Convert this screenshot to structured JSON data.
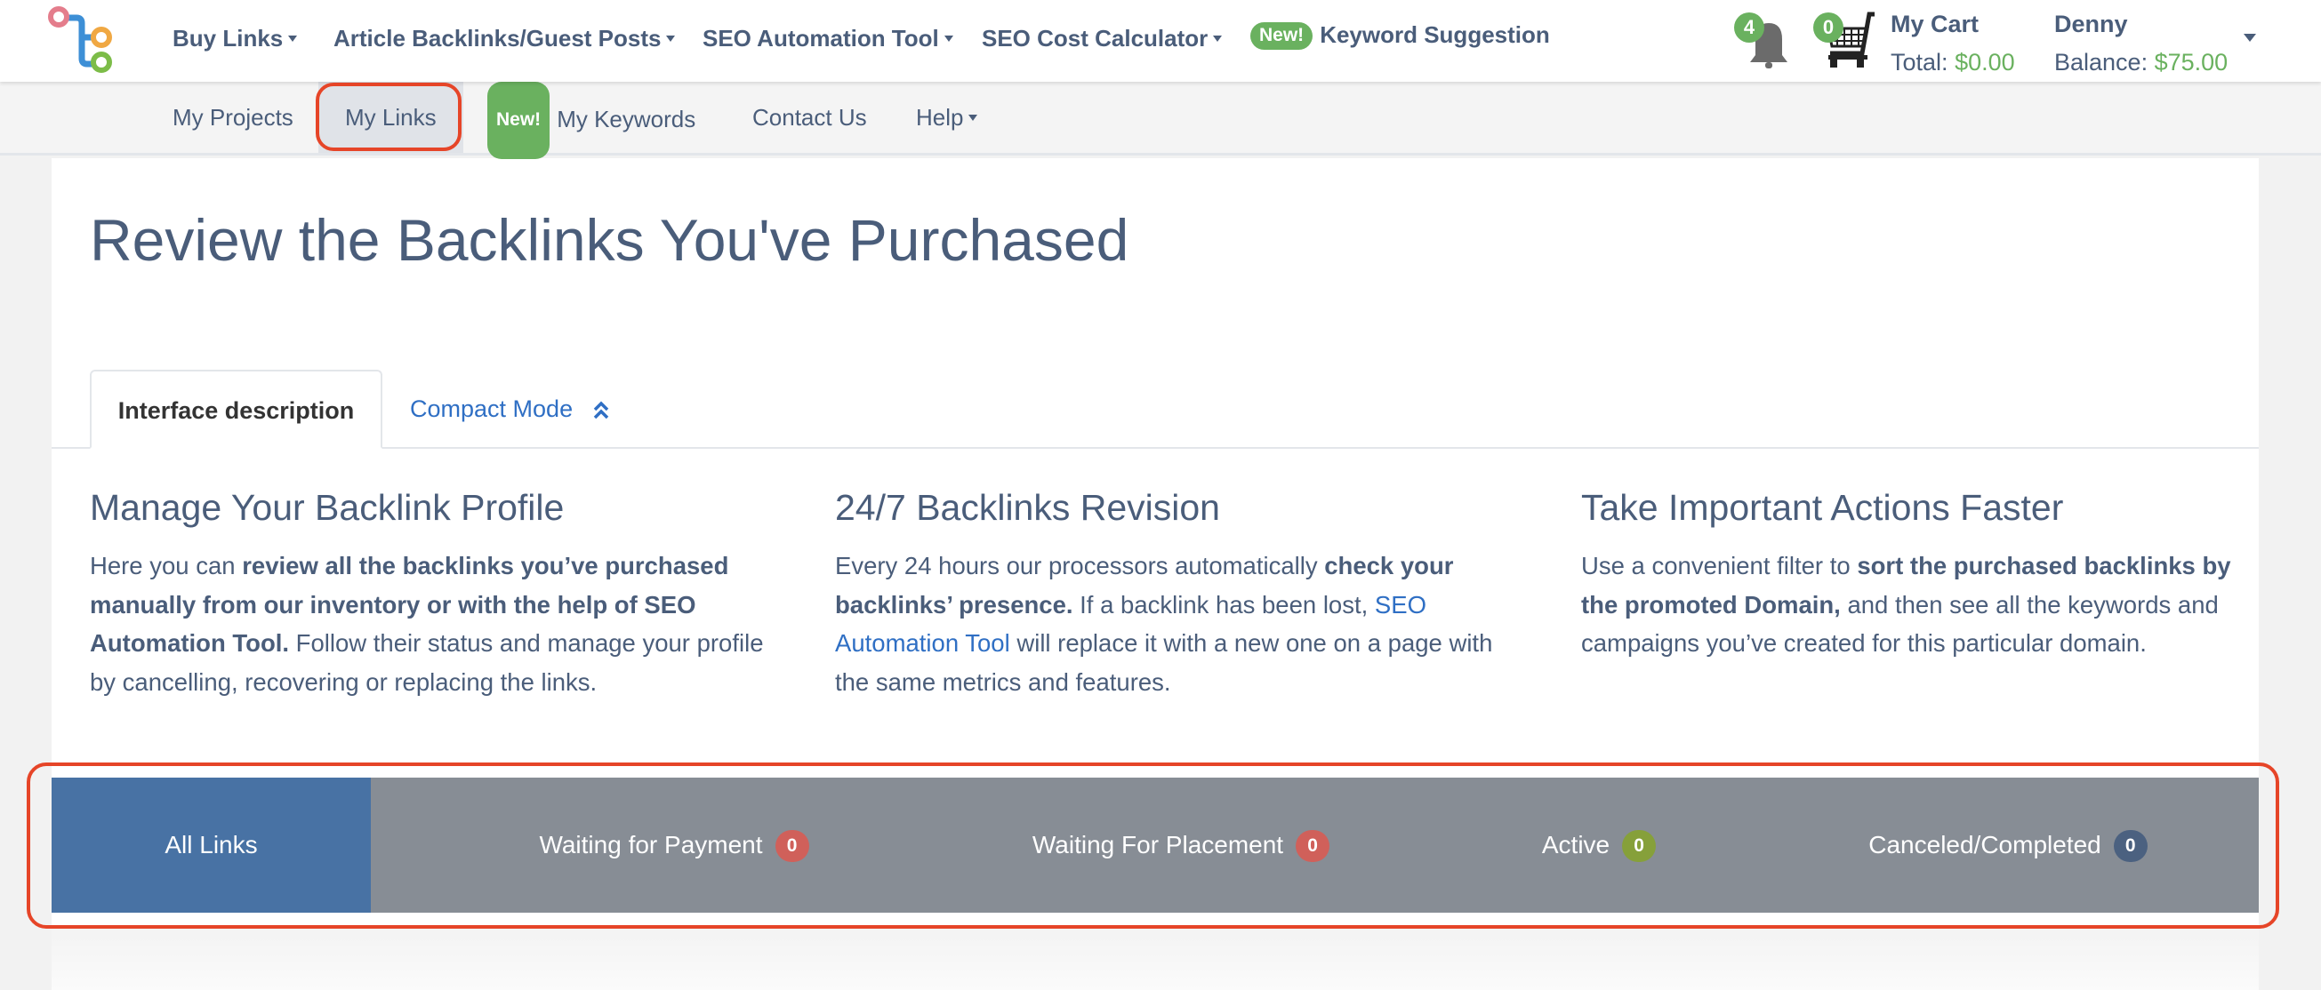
{
  "topnav": {
    "logo": "linkbuilder-logo",
    "items": [
      {
        "label": "Buy Links",
        "dropdown": true
      },
      {
        "label": "Article Backlinks/Guest Posts",
        "dropdown": true
      },
      {
        "label": "SEO Automation Tool",
        "dropdown": true
      },
      {
        "label": "SEO Cost Calculator",
        "dropdown": true
      },
      {
        "label": "Keyword Suggestion",
        "badge": "New!"
      }
    ],
    "notifications": {
      "icon": "bell-icon",
      "count": "4"
    },
    "cart": {
      "icon": "cart-icon",
      "count": "0",
      "title": "My Cart",
      "total_label": "Total:",
      "total_value": "$0.00"
    },
    "user": {
      "name": "Denny",
      "balance_label": "Balance:",
      "balance_value": "$75.00"
    }
  },
  "subnav": {
    "items": [
      {
        "label": "My Projects"
      },
      {
        "label": "My Links",
        "active": true
      },
      {
        "label": "My Keywords",
        "badge": "New!"
      },
      {
        "label": "Contact Us"
      },
      {
        "label": "Help",
        "dropdown": true
      }
    ]
  },
  "page": {
    "title": "Review the Backlinks You've Purchased",
    "tabs": [
      {
        "label": "Interface description",
        "active": true
      },
      {
        "label": "Compact Mode",
        "icon": "double-chevron-up-icon"
      }
    ],
    "columns": [
      {
        "heading": "Manage Your Backlink Profile",
        "segments": [
          {
            "text": "Here you can ",
            "style": "normal"
          },
          {
            "text": "review all the backlinks you’ve purchased manually from our inventory or with the help of SEO Automation Tool.",
            "style": "bold"
          },
          {
            "text": " Follow their status and manage your profile by cancelling, recovering or replacing the links.",
            "style": "normal"
          }
        ]
      },
      {
        "heading": "24/7 Backlinks Revision",
        "segments": [
          {
            "text": "Every 24 hours our processors automatically ",
            "style": "normal"
          },
          {
            "text": "check your backlinks’ presence.",
            "style": "bold"
          },
          {
            "text": " If a backlink has been lost, ",
            "style": "normal"
          },
          {
            "text": "SEO Automation Tool",
            "style": "link"
          },
          {
            "text": " will replace it with a new one on a page with the same metrics and features.",
            "style": "normal"
          }
        ]
      },
      {
        "heading": "Take Important Actions Faster",
        "segments": [
          {
            "text": "Use a convenient filter to ",
            "style": "normal"
          },
          {
            "text": "sort the purchased backlinks by the promoted Domain,",
            "style": "bold"
          },
          {
            "text": " and then see all the keywords and campaigns you’ve created for this particular domain.",
            "style": "normal"
          }
        ]
      }
    ]
  },
  "filters": [
    {
      "label": "All Links",
      "active": true
    },
    {
      "label": "Waiting for Payment",
      "count": "0",
      "badge_color": "#d0605a"
    },
    {
      "label": "Waiting For Placement",
      "count": "0",
      "badge_color": "#d0605a"
    },
    {
      "label": "Active",
      "count": "0",
      "badge_color": "#86a03a"
    },
    {
      "label": "Canceled/Completed",
      "count": "0",
      "badge_color": "#4b6180"
    }
  ],
  "colors": {
    "text": "#4a5d7a",
    "link": "#2f6fc4",
    "new_badge": "#6ab15f",
    "active_filter": "#4872a4",
    "filter_bar": "#878d95",
    "highlight": "#e64528"
  }
}
